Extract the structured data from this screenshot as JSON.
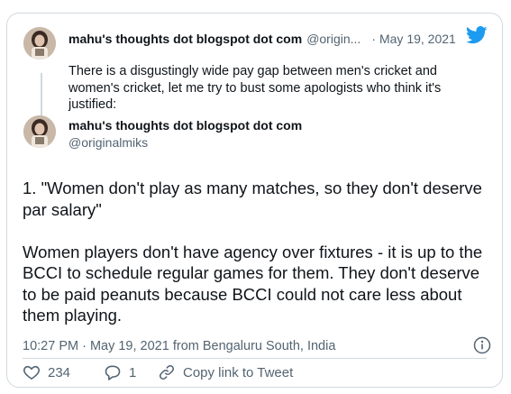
{
  "quoted_tweet": {
    "author_name": "mahu's thoughts dot blogspot dot com",
    "author_handle": "@origin...",
    "separator": "·",
    "date": "May 19, 2021",
    "text": "There is a disgustingly wide pay gap between men's cricket and women's cricket, let me try to bust some apologists who think it's justified:"
  },
  "tweet": {
    "author_name": "mahu's thoughts dot blogspot dot com",
    "author_handle": "@originalmiks",
    "paragraphs": [
      "1. \"Women don't play as many matches, so they don't deserve par salary\"",
      "Women players don't have agency over fixtures - it is up to the BCCI to schedule regular games for them. They don't deserve to be paid peanuts because BCCI could not care less about them playing."
    ],
    "timestamp": "10:27 PM · May 19, 2021 from Bengaluru South, India"
  },
  "actions": {
    "likes": "234",
    "replies": "1",
    "copy_link": "Copy link to Tweet"
  },
  "colors": {
    "twitter_blue": "#1d9bf0",
    "like_pink": "#f91880",
    "text_primary": "#0f1419",
    "text_secondary": "#536471",
    "border": "#cfd9de"
  },
  "icons": {
    "brand": "twitter-bird-icon",
    "info": "info-icon",
    "like": "heart-icon",
    "reply": "reply-bubble-icon",
    "copy": "link-icon"
  }
}
